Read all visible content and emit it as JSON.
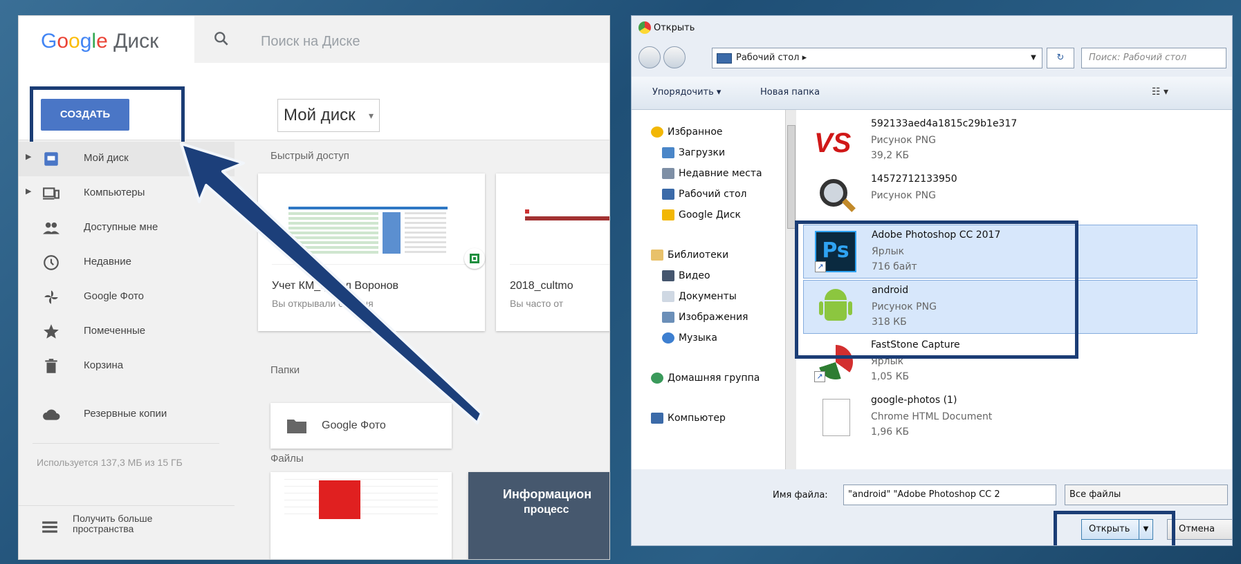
{
  "drive": {
    "logo": {
      "brand": [
        "G",
        "o",
        "o",
        "g",
        "l",
        "e"
      ],
      "product": "Диск"
    },
    "search_placeholder": "Поиск на Диске",
    "create_label": "СОЗДАТЬ",
    "my_disk_dropdown": "Мой диск",
    "sidebar": [
      {
        "label": "Мой диск",
        "icon": "drive-icon",
        "active": true
      },
      {
        "label": "Компьютеры",
        "icon": "computer-icon"
      },
      {
        "label": "Доступные мне",
        "icon": "people-icon"
      },
      {
        "label": "Недавние",
        "icon": "clock-icon"
      },
      {
        "label": "Google Фото",
        "icon": "pinwheel-icon"
      },
      {
        "label": "Помеченные",
        "icon": "star-icon"
      },
      {
        "label": "Корзина",
        "icon": "trash-icon"
      },
      {
        "label": "Резервные копии",
        "icon": "cloud-icon"
      }
    ],
    "storage_text": "Используется 137,3 МБ из 15 ГБ",
    "get_more_storage": [
      "Получить больше",
      "пространства"
    ],
    "quick_access_label": "Быстрый доступ",
    "quick_access": [
      {
        "name": "Учет КМ_ф_ ил Воронов",
        "sub": "Вы открывали сегодня"
      },
      {
        "name": "2018_cultmo",
        "sub": "Вы часто от"
      }
    ],
    "folders_label": "Папки",
    "folder_name": "Google Фото",
    "files_label": "Файлы",
    "file_card_text": [
      "Информацион",
      "процесс"
    ]
  },
  "dialog": {
    "title": "Открыть",
    "address": "Рабочий стол",
    "search_placeholder": "Поиск: Рабочий стол",
    "toolbar": {
      "organize": "Упорядочить ▾",
      "new_folder": "Новая папка"
    },
    "nav": {
      "favorites": "Избранное",
      "downloads": "Загрузки",
      "recent": "Недавние места",
      "desktop": "Рабочий стол",
      "gdrive": "Google Диск",
      "libraries": "Библиотеки",
      "video": "Видео",
      "documents": "Документы",
      "images": "Изображения",
      "music": "Музыка",
      "homegroup": "Домашняя группа",
      "computer": "Компьютер"
    },
    "files": [
      {
        "name": "592133aed4a1815c29b1e317",
        "type": "Рисунок PNG",
        "size": "39,2 КБ"
      },
      {
        "name": "14572712133950",
        "type": "Рисунок PNG",
        "size": ""
      },
      {
        "name": "Adobe Photoshop CC 2017",
        "type": "Ярлык",
        "size": "716 байт"
      },
      {
        "name": "android",
        "type": "Рисунок PNG",
        "size": "318 КБ"
      },
      {
        "name": "FastStone Capture",
        "type": "Ярлык",
        "size": "1,05 КБ"
      },
      {
        "name": "google-photos (1)",
        "type": "Chrome HTML Document",
        "size": "1,96 КБ"
      }
    ],
    "filename_label": "Имя файла:",
    "filename_value": "\"android\" \"Adobe Photoshop CC 2",
    "filetype_value": "Все файлы",
    "open_label": "Открыть",
    "cancel_label": "Отмена"
  },
  "colors": {
    "highlight": "#1b3d75",
    "create": "#4a76c6"
  }
}
